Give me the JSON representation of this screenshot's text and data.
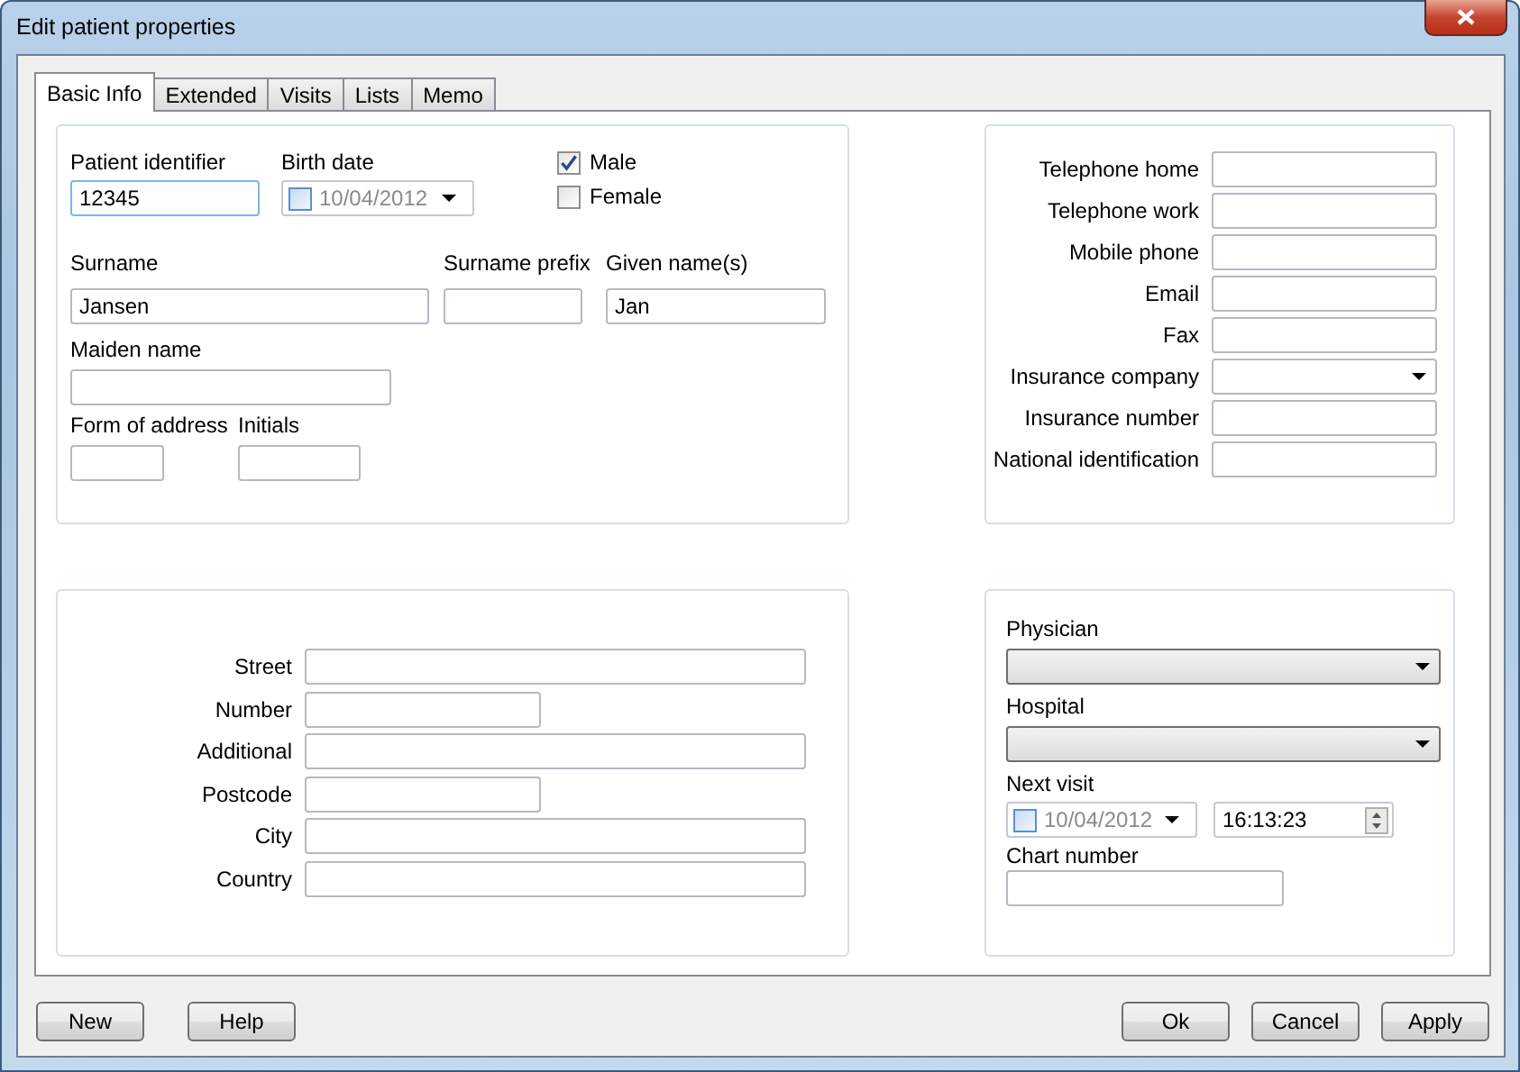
{
  "window": {
    "title": "Edit patient properties"
  },
  "tabs": [
    {
      "label": "Basic Info",
      "selected": true
    },
    {
      "label": "Extended",
      "selected": false
    },
    {
      "label": "Visits",
      "selected": false
    },
    {
      "label": "Lists",
      "selected": false
    },
    {
      "label": "Memo",
      "selected": false
    }
  ],
  "identity": {
    "patient_identifier": {
      "label": "Patient identifier",
      "value": "12345"
    },
    "birth_date": {
      "label": "Birth date",
      "value": "10/04/2012",
      "checked": false
    },
    "gender": [
      {
        "label": "Male",
        "checked": true
      },
      {
        "label": "Female",
        "checked": false
      }
    ],
    "surname": {
      "label": "Surname",
      "value": "Jansen"
    },
    "surname_prefix": {
      "label": "Surname prefix"
    },
    "given_names": {
      "label": "Given name(s)",
      "value": "Jan"
    },
    "maiden_name": {
      "label": "Maiden name"
    },
    "form_of_address": {
      "label": "Form of address"
    },
    "initials": {
      "label": "Initials"
    }
  },
  "contact": [
    {
      "label": "Telephone home",
      "kind": "text"
    },
    {
      "label": "Telephone work",
      "kind": "text"
    },
    {
      "label": "Mobile phone",
      "kind": "text"
    },
    {
      "label": "Email",
      "kind": "text"
    },
    {
      "label": "Fax",
      "kind": "text"
    },
    {
      "label": "Insurance company",
      "kind": "combo"
    },
    {
      "label": "Insurance number",
      "kind": "text"
    },
    {
      "label": "National identification",
      "kind": "text"
    }
  ],
  "address": [
    {
      "label": "Street"
    },
    {
      "label": "Number"
    },
    {
      "label": "Additional"
    },
    {
      "label": "Postcode"
    },
    {
      "label": "City"
    },
    {
      "label": "Country"
    }
  ],
  "care": {
    "physician": {
      "label": "Physician"
    },
    "hospital": {
      "label": "Hospital"
    },
    "next_visit": {
      "label": "Next visit",
      "date": "10/04/2012",
      "checked": false,
      "time": "16:13:23"
    },
    "chart_number": {
      "label": "Chart number"
    }
  },
  "buttons_left": [
    "New",
    "Help"
  ],
  "buttons_right": [
    "Ok",
    "Cancel",
    "Apply"
  ]
}
